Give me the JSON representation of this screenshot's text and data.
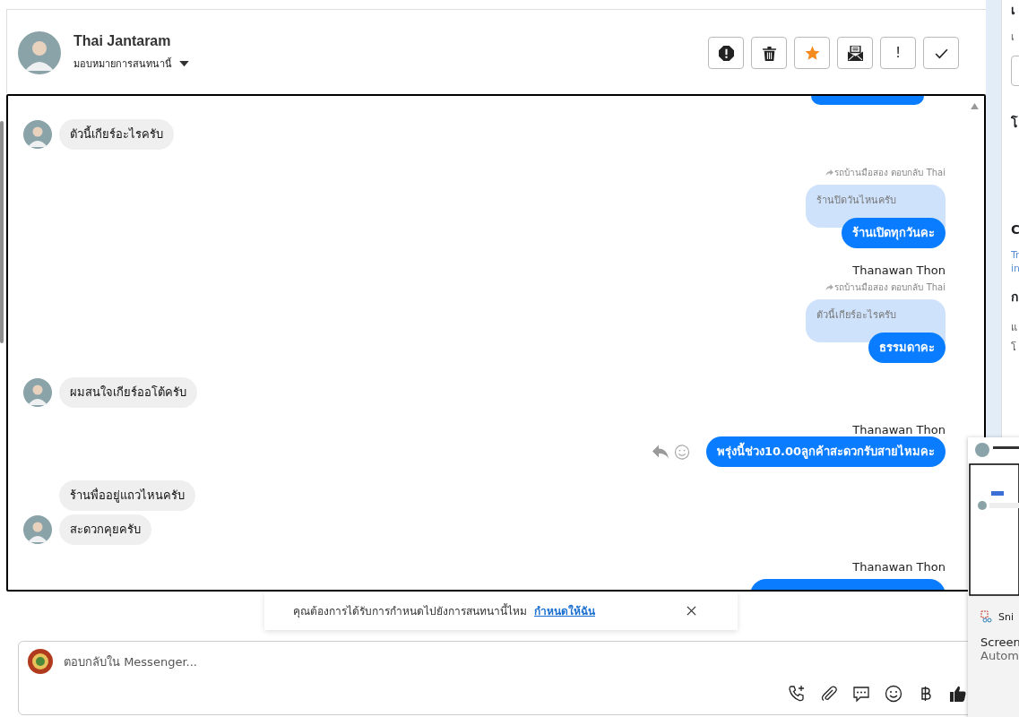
{
  "contact": {
    "name": "Thai Jantaram",
    "assign_label": "มอบหมายการสนทนานี้"
  },
  "actions": [
    {
      "kind": "alert"
    },
    {
      "kind": "trash"
    },
    {
      "kind": "star"
    },
    {
      "kind": "mail"
    },
    {
      "kind": "text",
      "label": "!"
    },
    {
      "kind": "check"
    }
  ],
  "messages": [
    {
      "kind": "cut"
    },
    {
      "kind": "incoming",
      "text": "ตัวนี้เกียร์อะไรครับ",
      "avatar": true
    },
    {
      "kind": "outgoing",
      "reply_note": "รถบ้านมือสอง ตอบกลับ Thai",
      "quoted": "ร้านปิดวันไหนครับ",
      "text": "ร้านเปิดทุกวันคะ"
    },
    {
      "kind": "outgoing",
      "sender": "Thanawan Thon",
      "reply_note": "รถบ้านมือสอง ตอบกลับ Thai",
      "quoted": "ตัวนี้เกียร์อะไรครับ",
      "text": "ธรรมดาคะ"
    },
    {
      "kind": "incoming",
      "text": "ผมสนใจเกียร์ออโต้ครับ",
      "avatar": true
    },
    {
      "kind": "outgoing",
      "sender": "Thanawan Thon",
      "text": "พรุ่งนี้ช่วง10.00ลูกค้าสะดวกรับสายไหมคะ",
      "tools": true
    },
    {
      "kind": "incoming",
      "text": "ร้านพื่ออยู่แถวไหนครับ",
      "avatar": false
    },
    {
      "kind": "incoming",
      "text": "สะดวกคุยครับ",
      "avatar": true
    },
    {
      "kind": "cut_bottom",
      "sender": "Thanawan Thon"
    }
  ],
  "banner": {
    "text": "คุณต้องการได้รับการกำหนดไปยังการสนทนานี้ไหม",
    "link": "กำหนดให้ฉัน"
  },
  "composer": {
    "placeholder": "ตอบกลับใน Messenger..."
  },
  "sidebar": [
    {
      "kind": "title",
      "text": "เ"
    },
    {
      "kind": "note",
      "text": "เ"
    },
    {
      "kind": "field"
    },
    {
      "kind": "title",
      "text": "โ"
    },
    {
      "kind": "title",
      "text": "C"
    },
    {
      "kind": "link",
      "text": "Tr"
    },
    {
      "kind": "link",
      "text": "in"
    },
    {
      "kind": "title",
      "text": "ก"
    },
    {
      "kind": "note",
      "text": "แ"
    },
    {
      "kind": "note",
      "text": "โ"
    }
  ],
  "snip": {
    "title": "Sni",
    "line_1": "Screen",
    "line_2": "Autom"
  }
}
